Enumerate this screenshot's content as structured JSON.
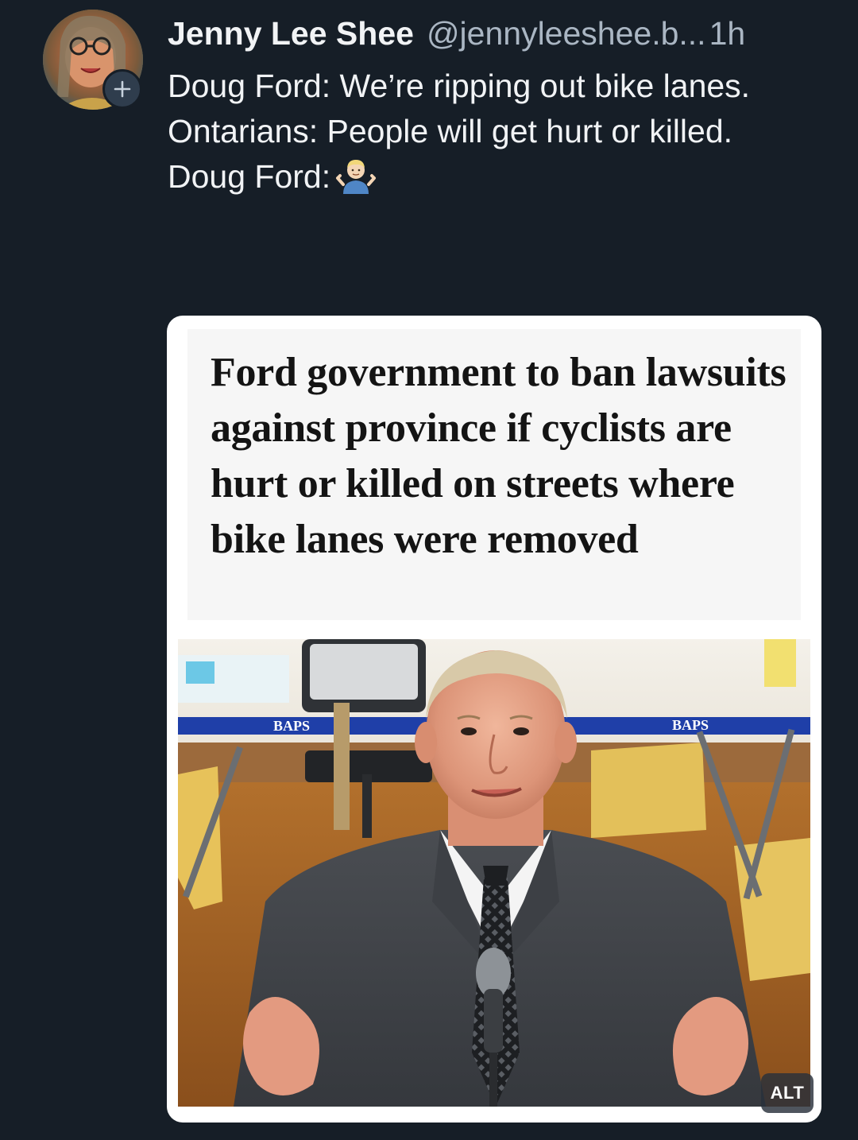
{
  "post": {
    "author": {
      "display_name": "Jenny Lee Shee",
      "handle": "@jennyleeshee.b...",
      "avatar_icon": "avatar-portrait",
      "follow_icon": "plus-icon"
    },
    "timestamp": "1h",
    "text_lines": [
      "Doug Ford: We’re ripping out bike lanes.",
      "Ontarians: People will get hurt or killed.",
      "Doug Ford:"
    ],
    "shrug_emoji": "🤷🏼‍♂️",
    "media": {
      "headline": "Ford government to ban lawsuits against province if cyclists are hurt or killed on streets where bike lanes were removed",
      "photo_banner_text": "BAPS",
      "alt_label": "ALT"
    }
  },
  "colors": {
    "background": "#161e27",
    "text_primary": "#f1f3f5",
    "text_secondary": "#aab6c3",
    "badge_bg": "#2f3d4d"
  }
}
